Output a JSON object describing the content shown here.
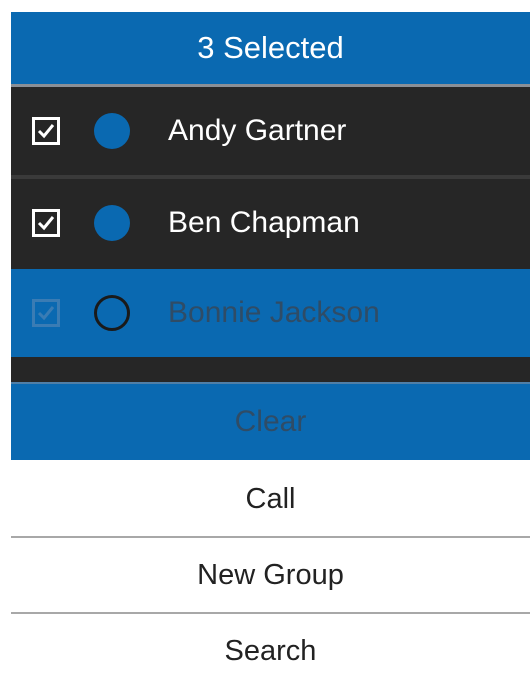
{
  "header": {
    "title": "3 Selected"
  },
  "contacts": [
    {
      "name": "Andy Gartner",
      "checked": true,
      "selected": false
    },
    {
      "name": "Ben Chapman",
      "checked": true,
      "selected": false
    },
    {
      "name": "Bonnie Jackson",
      "checked": true,
      "selected": true
    }
  ],
  "actions": {
    "clear_label": "Clear",
    "call_label": "Call",
    "new_group_label": "New Group",
    "search_label": "Search"
  },
  "colors": {
    "accent": "#0a69b1",
    "list_bg": "#262626",
    "menu_bg": "#ffffff"
  },
  "icons": {
    "checkbox": "checkbox-checked-icon",
    "presence": "presence-dot-icon"
  }
}
